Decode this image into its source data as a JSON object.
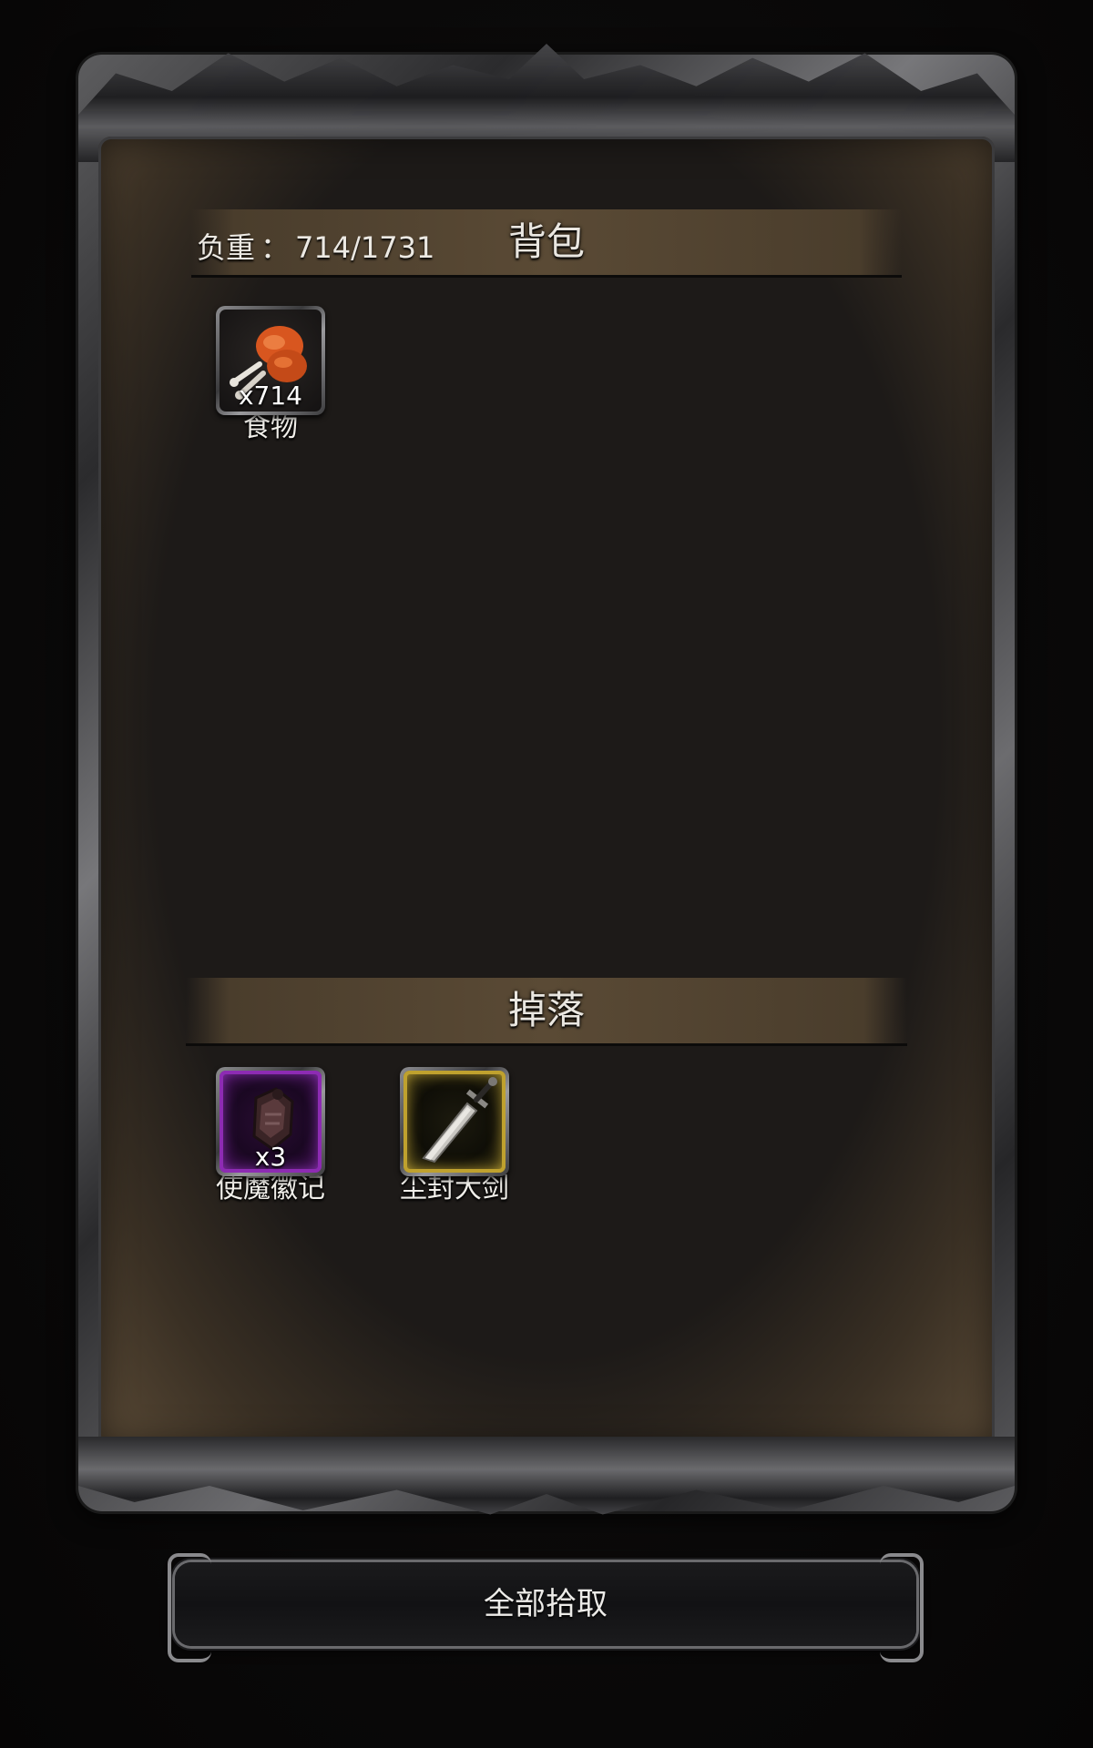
{
  "inventory": {
    "title": "背包",
    "weight_label": "负重",
    "weight_separator": "：",
    "weight_value": "714/1731",
    "items": [
      {
        "name": "食物",
        "count": "x714",
        "icon": "roast-meat-icon"
      }
    ]
  },
  "drops": {
    "title": "掉落",
    "items": [
      {
        "name": "使魔徽记",
        "count": "x3",
        "icon": "familiar-emblem-icon",
        "rarity_color": "#8d2bb3"
      },
      {
        "name": "尘封大剑",
        "count": "",
        "icon": "greatsword-icon",
        "rarity_color": "#bfa12e"
      }
    ]
  },
  "actions": {
    "collect_all_label": "全部拾取"
  }
}
